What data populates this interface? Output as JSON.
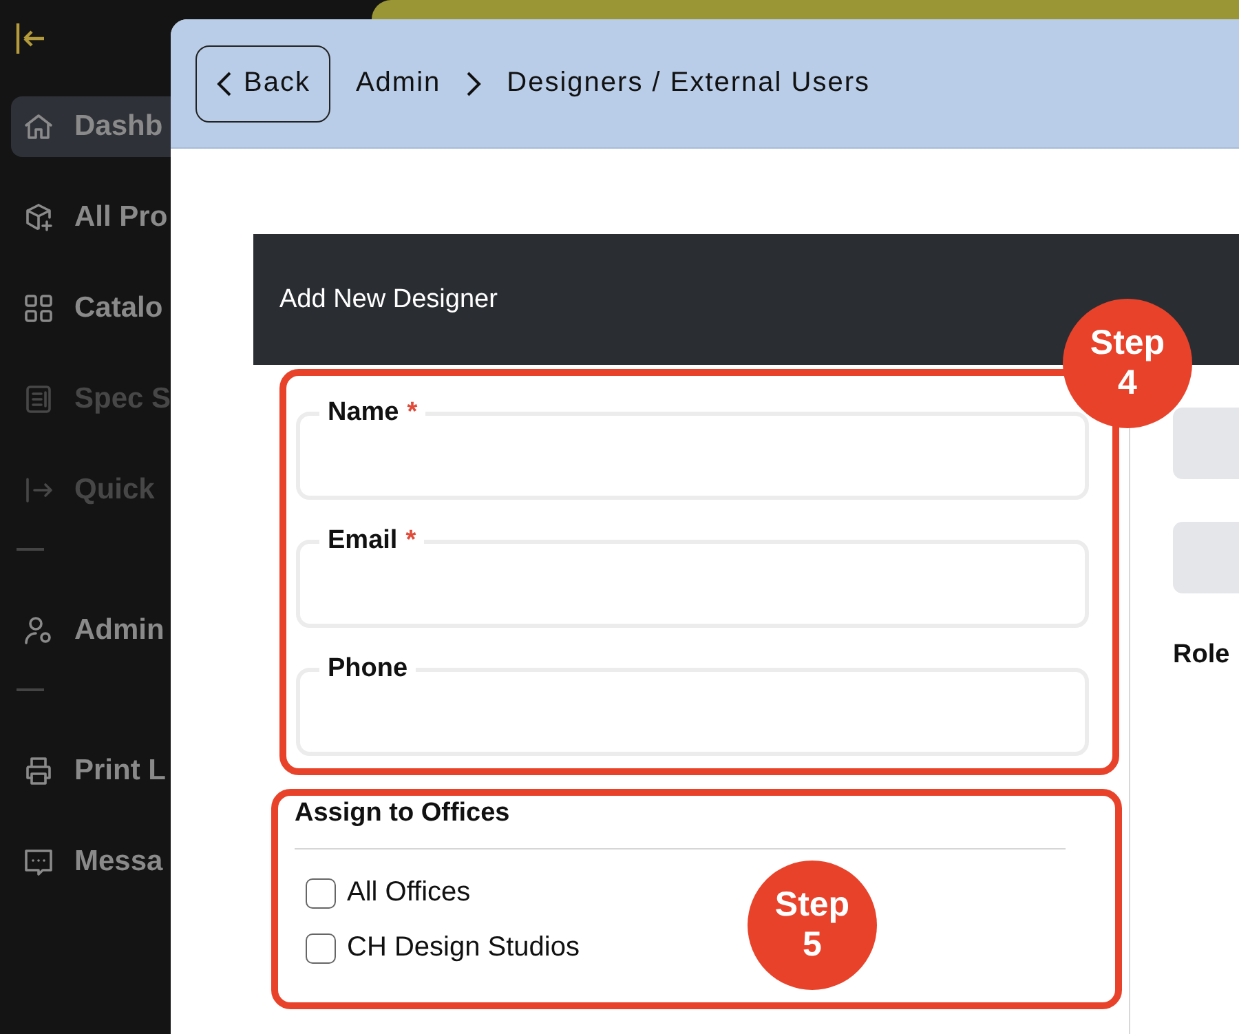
{
  "sidebar": {
    "items": [
      {
        "label": "Dashb",
        "selected": true,
        "disabled": false
      },
      {
        "label": "All Pro",
        "selected": false,
        "disabled": false
      },
      {
        "label": "Catalo",
        "selected": false,
        "disabled": false
      },
      {
        "label": "Spec S",
        "selected": false,
        "disabled": true
      },
      {
        "label": "Quick",
        "selected": false,
        "disabled": true
      },
      {
        "label": "Admin",
        "selected": false,
        "disabled": false,
        "divider_before": true
      },
      {
        "label": "Print L",
        "selected": false,
        "disabled": false,
        "divider_before": true
      },
      {
        "label": "Messa",
        "selected": false,
        "disabled": false
      }
    ]
  },
  "modal": {
    "back_button": "Back",
    "breadcrumb": [
      "Admin",
      "Designers / External Users"
    ],
    "card": {
      "title": "Add New Designer",
      "fields": [
        {
          "label": "Name",
          "required_mark": "*"
        },
        {
          "label": "Email",
          "required_mark": "*"
        },
        {
          "label": "Phone"
        }
      ],
      "offices": {
        "title": "Assign to Offices",
        "options": [
          {
            "label": "All Offices",
            "checked": false
          },
          {
            "label": "CH Design Studios",
            "checked": false
          }
        ]
      },
      "right_column": {
        "label": "Role"
      }
    }
  },
  "annotations": [
    {
      "label": "Step 4"
    },
    {
      "label": "Step 5"
    }
  ]
}
